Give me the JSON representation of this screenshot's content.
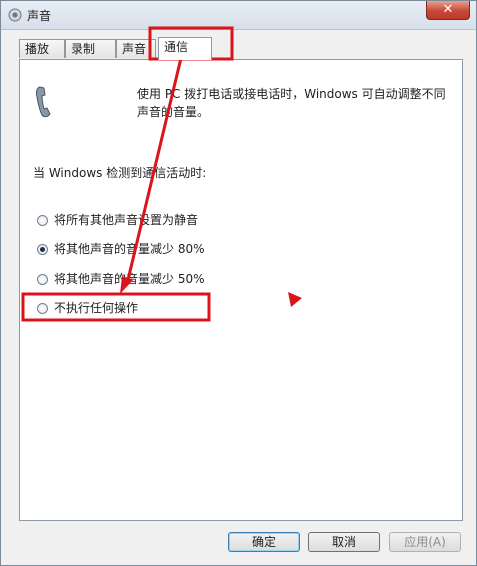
{
  "window": {
    "title": "声音",
    "close_label": "✕"
  },
  "tabs": [
    {
      "label": "播放",
      "active": false
    },
    {
      "label": "录制",
      "active": false
    },
    {
      "label": "声音",
      "active": false
    },
    {
      "label": "通信",
      "active": true
    }
  ],
  "panel": {
    "description": "使用 PC 拨打电话或接电话时，Windows 可自动调整不同声音的音量。",
    "group_label": "当 Windows 检测到通信活动时:",
    "options": [
      {
        "label": "将所有其他声音设置为静音",
        "checked": false
      },
      {
        "label": "将其他声音的音量减少 80%",
        "checked": true
      },
      {
        "label": "将其他声音的音量减少 50%",
        "checked": false
      },
      {
        "label": "不执行任何操作",
        "checked": false
      }
    ]
  },
  "buttons": {
    "ok": "确定",
    "cancel": "取消",
    "apply": "应用(A)"
  },
  "colors": {
    "annotation": "#d9141b",
    "accent": "#3c7fb1"
  },
  "icons": {
    "title": "speaker-icon",
    "panel": "telephone-icon"
  }
}
